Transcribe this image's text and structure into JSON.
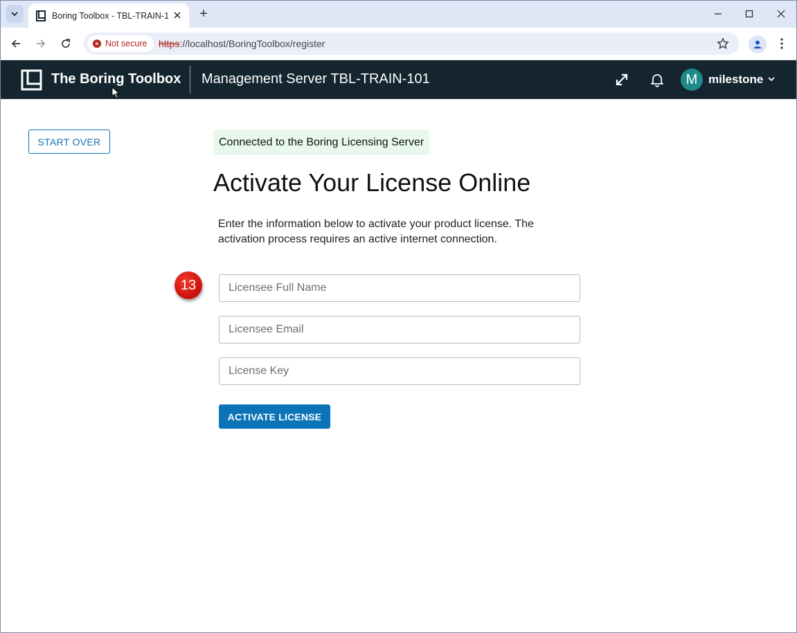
{
  "browser": {
    "tab_title": "Boring Toolbox - TBL-TRAIN-101",
    "new_tab_symbol": "+",
    "security_label": "Not secure",
    "url_scheme": "https",
    "url_rest": "://localhost/BoringToolbox/register"
  },
  "app_header": {
    "app_name": "The Boring Toolbox",
    "server_name": "Management Server TBL-TRAIN-101",
    "avatar_initial": "M",
    "user_name": "milestone"
  },
  "content": {
    "start_over_label": "START OVER",
    "connection_status": "Connected to the Boring Licensing Server",
    "title": "Activate Your License Online",
    "intro_text": "Enter the information below to activate your product license. The activation process requires an active internet connection.",
    "step_number": "13",
    "fields": {
      "full_name_placeholder": "Licensee Full Name",
      "email_placeholder": "Licensee Email",
      "license_key_placeholder": "License Key"
    },
    "activate_label": "ACTIVATE LICENSE"
  },
  "colors": {
    "header_bg": "#14252f",
    "accent": "#0b73b8",
    "status_bg": "#e8f8ec",
    "badge": "#d1130e",
    "avatar": "#1e8a8a"
  }
}
